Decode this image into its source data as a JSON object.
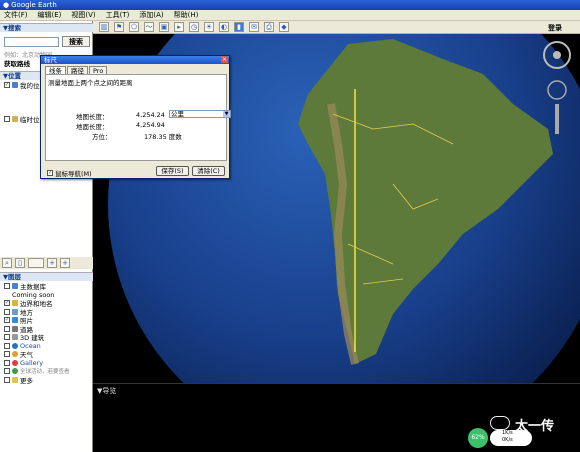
{
  "window": {
    "title": "Google Earth"
  },
  "menu": [
    "文件(F)",
    "编辑(E)",
    "视图(V)",
    "工具(T)",
    "添加(A)",
    "帮助(H)"
  ],
  "toolbar": {
    "login_label": "登录"
  },
  "sidebar": {
    "search_header": "▼搜索",
    "search_button": "搜索",
    "search_example": "例如：北京动物园",
    "route_link": "获取路线",
    "places_header": "▼位置",
    "places_items": [
      "我的位置",
      "临时位置"
    ],
    "layers_header": "▼图层",
    "layers_items": [
      "主数据库",
      "Coming soon",
      "边界和地名",
      "地方",
      "照片",
      "道路",
      "3D 建筑",
      "Ocean",
      "天气",
      "Gallery",
      "全球活动，若要查看",
      "更多"
    ]
  },
  "dialog": {
    "title": "标尺",
    "tabs": [
      "线条",
      "路径",
      "Pro"
    ],
    "description": "测量地面上两个点之间的距离",
    "map_length_label": "地图长度：",
    "map_length_value": "4,254.24",
    "ground_length_label": "地面长度：",
    "ground_length_value": "4,254.94",
    "heading_label": "方位：",
    "heading_value": "178.35 度数",
    "unit": "公里",
    "mouse_nav_label": "鼠标导航(M)",
    "save_button": "保存(S)",
    "clear_button": "清除(C)"
  },
  "bottom": {
    "nav_label": "▼导览"
  },
  "overlay": {
    "watermark": "太一传",
    "fps": "62%",
    "status_lines": [
      "1K/s",
      "0K/s"
    ]
  }
}
